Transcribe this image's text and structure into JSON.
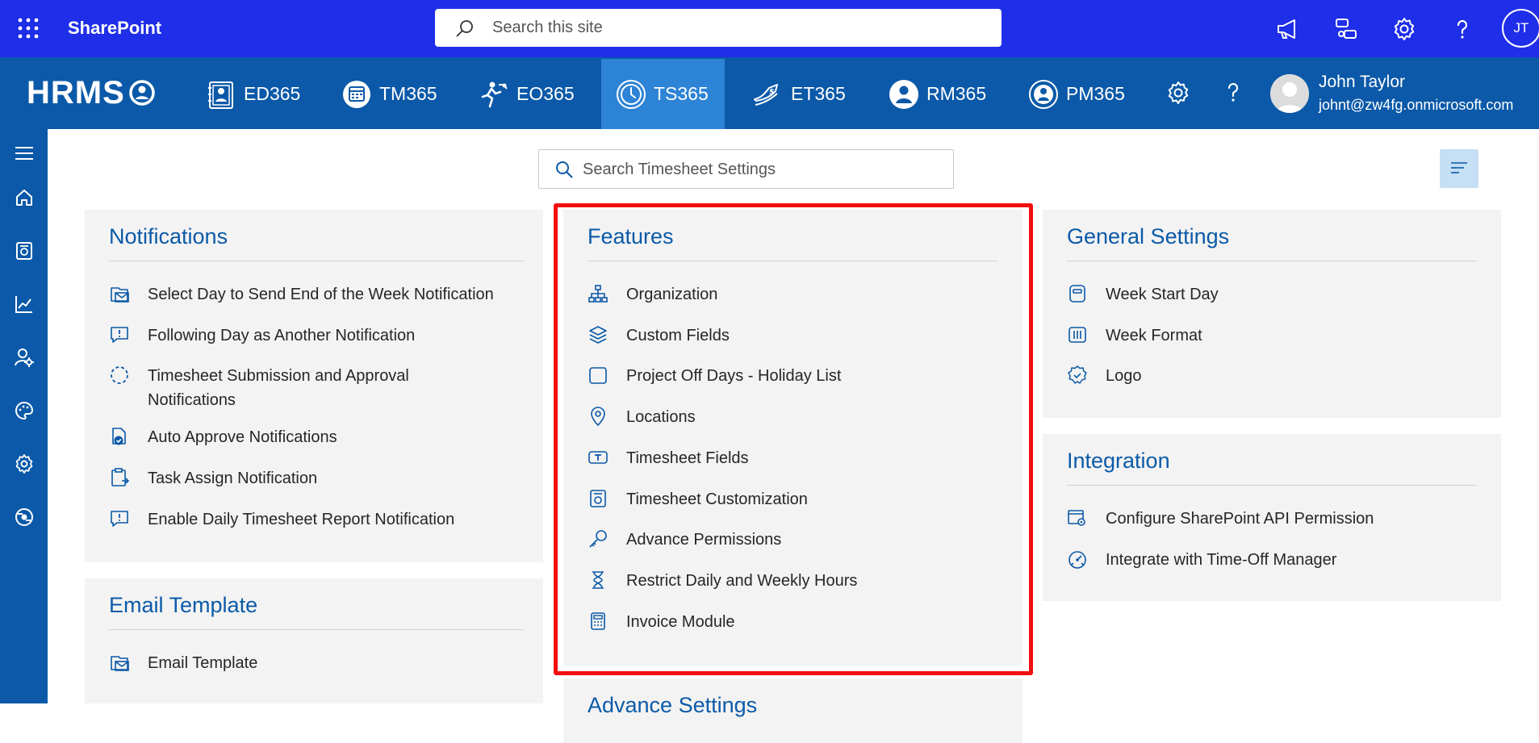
{
  "sharepoint": {
    "title": "SharePoint",
    "search_placeholder": "Search this site",
    "avatar_initials": "JT"
  },
  "nav": {
    "logo": "HRMS",
    "items": [
      {
        "label": "ED365"
      },
      {
        "label": "TM365"
      },
      {
        "label": "EO365"
      },
      {
        "label": "TS365",
        "active": true
      },
      {
        "label": "ET365"
      },
      {
        "label": "RM365"
      },
      {
        "label": "PM365"
      }
    ],
    "user": {
      "name": "John Taylor",
      "email": "johnt@zw4fg.onmicrosoft.com"
    }
  },
  "content": {
    "search_placeholder": "Search Timesheet Settings"
  },
  "cards": {
    "notifications": {
      "title": "Notifications",
      "items": [
        "Select Day to Send End of the Week Notification",
        "Following Day as Another Notification",
        "Timesheet Submission and Approval Notifications",
        "Auto Approve Notifications",
        "Task Assign Notification",
        "Enable Daily Timesheet Report Notification"
      ]
    },
    "email_template": {
      "title": "Email Template",
      "items": [
        "Email Template"
      ]
    },
    "features": {
      "title": "Features",
      "items": [
        "Organization",
        "Custom Fields",
        "Project Off Days - Holiday List",
        "Locations",
        "Timesheet Fields",
        "Timesheet Customization",
        "Advance Permissions",
        "Restrict Daily and Weekly Hours",
        "Invoice Module"
      ]
    },
    "advance_settings": {
      "title": "Advance Settings"
    },
    "general_settings": {
      "title": "General Settings",
      "items": [
        "Week Start Day",
        "Week Format",
        "Logo"
      ]
    },
    "integration": {
      "title": "Integration",
      "items": [
        "Configure SharePoint API Permission",
        "Integrate with Time-Off Manager"
      ]
    }
  },
  "colors": {
    "sharepoint_bar": "#1f2ee8",
    "nav_bar": "#0b59a8",
    "active_tab": "#2d83d6",
    "card_title": "#0b5aa8",
    "highlight_border": "#f20f0f"
  }
}
